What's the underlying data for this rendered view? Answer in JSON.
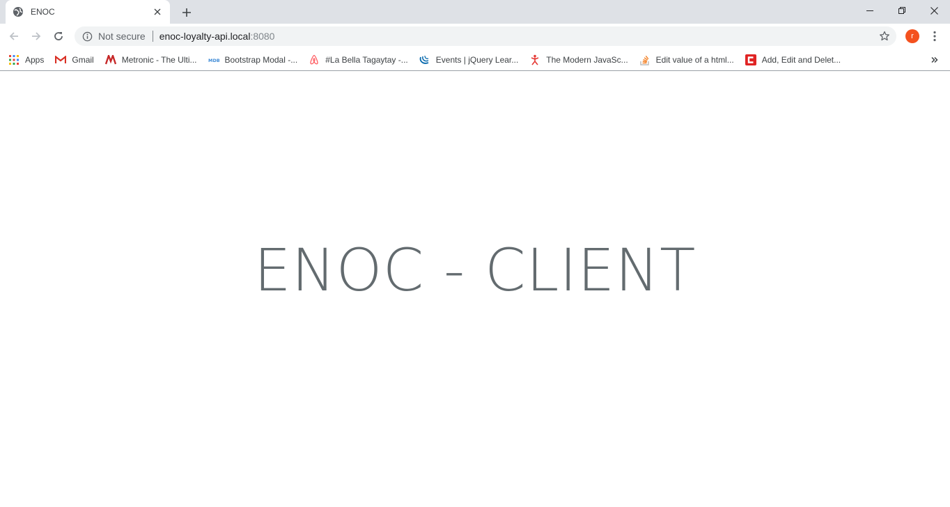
{
  "browser": {
    "tab": {
      "title": "ENOC",
      "favicon": "globe-icon"
    },
    "new_tab_icon": "plus-icon",
    "window_controls": [
      "minimize-icon",
      "restore-icon",
      "close-icon"
    ]
  },
  "toolbar": {
    "back_icon": "back-arrow-icon",
    "forward_icon": "forward-arrow-icon",
    "reload_icon": "reload-icon",
    "omnibox": {
      "security_label": "Not secure",
      "url_host": "enoc-loyalty-api.local",
      "url_port": ":8080"
    },
    "bookmark_star_icon": "star-icon",
    "profile_initial": "r",
    "profile_color": "#f4511e",
    "menu_icon": "kebab-menu-icon"
  },
  "bookmarks": [
    {
      "label": "Apps",
      "icon": "apps-grid-icon"
    },
    {
      "label": "Gmail",
      "icon": "gmail-icon"
    },
    {
      "label": "Metronic - The Ulti...",
      "icon": "metronic-icon"
    },
    {
      "label": "Bootstrap Modal -...",
      "icon": "mdb-icon"
    },
    {
      "label": "#La Bella Tagaytay -...",
      "icon": "airbnb-icon"
    },
    {
      "label": "Events | jQuery Lear...",
      "icon": "jquery-icon"
    },
    {
      "label": "The Modern JavaSc...",
      "icon": "javascript-info-icon"
    },
    {
      "label": "Edit value of a html...",
      "icon": "stackoverflow-icon"
    },
    {
      "label": "Add, Edit and Delet...",
      "icon": "codeproject-icon"
    }
  ],
  "page": {
    "title": "ENOC - CLIENT",
    "title_color": "#636b6f"
  }
}
